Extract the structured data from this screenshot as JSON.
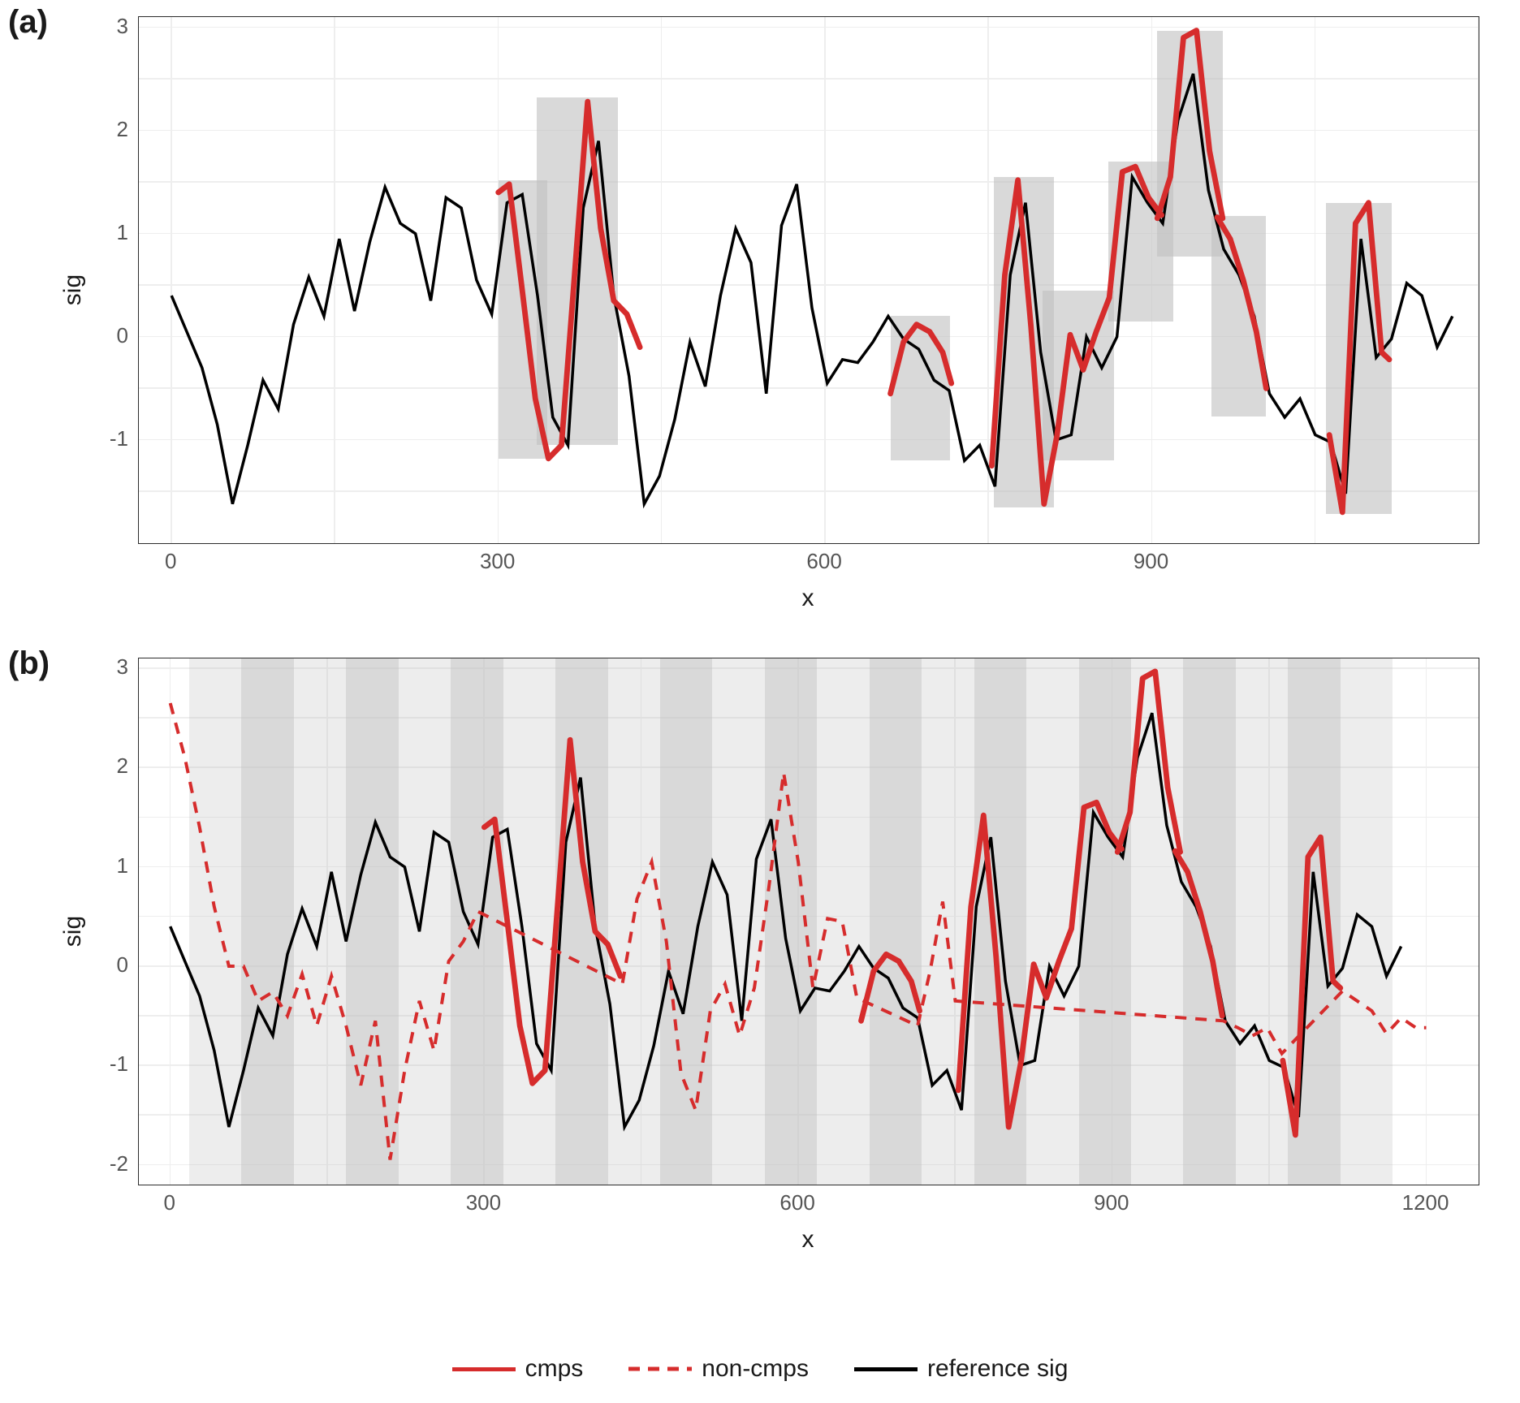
{
  "chart_data": [
    {
      "id": "a",
      "type": "line",
      "panel_label": "(a)",
      "xlabel": "x",
      "ylabel": "sig",
      "xlim": [
        -30,
        1200
      ],
      "ylim": [
        -2.0,
        3.1
      ],
      "xticks": [
        0,
        300,
        600,
        900
      ],
      "yticks": [
        -1,
        0,
        1,
        2,
        3
      ],
      "shaded_segments": [
        {
          "x0": 300,
          "x1": 345,
          "y0": -1.18,
          "y1": 1.52
        },
        {
          "x0": 335,
          "x1": 410,
          "y0": -1.05,
          "y1": 2.32
        },
        {
          "x0": 660,
          "x1": 715,
          "y0": -1.2,
          "y1": 0.2
        },
        {
          "x0": 755,
          "x1": 810,
          "y0": -1.65,
          "y1": 1.55
        },
        {
          "x0": 800,
          "x1": 865,
          "y0": -1.2,
          "y1": 0.45
        },
        {
          "x0": 860,
          "x1": 920,
          "y0": 0.15,
          "y1": 1.7
        },
        {
          "x0": 905,
          "x1": 965,
          "y0": 0.78,
          "y1": 2.97
        },
        {
          "x0": 955,
          "x1": 1005,
          "y0": -0.77,
          "y1": 1.17
        },
        {
          "x0": 1060,
          "x1": 1120,
          "y0": -1.72,
          "y1": 1.3
        }
      ],
      "series": [
        {
          "name": "reference sig",
          "style": "solid-black",
          "x": [
            0,
            14,
            28,
            42,
            56,
            70,
            84,
            98,
            112,
            126,
            140,
            154,
            168,
            182,
            196,
            210,
            224,
            238,
            252,
            266,
            280,
            294,
            308,
            322,
            336,
            350,
            364,
            378,
            392,
            406,
            420,
            434,
            448,
            462,
            476,
            490,
            504,
            518,
            532,
            546,
            560,
            574,
            588,
            602,
            616,
            630,
            644,
            658,
            672,
            686,
            700,
            714,
            728,
            742,
            756,
            770,
            784,
            798,
            812,
            826,
            840,
            854,
            868,
            882,
            896,
            910,
            924,
            938,
            952,
            966,
            980,
            994,
            1008,
            1022,
            1036,
            1050,
            1064,
            1078,
            1092,
            1106,
            1120,
            1134,
            1148,
            1162,
            1176
          ],
          "y": [
            0.4,
            0.05,
            -0.3,
            -0.85,
            -1.62,
            -1.05,
            -0.42,
            -0.7,
            0.12,
            0.58,
            0.2,
            0.95,
            0.25,
            0.92,
            1.45,
            1.1,
            1.0,
            0.35,
            1.35,
            1.25,
            0.55,
            0.22,
            1.3,
            1.38,
            0.4,
            -0.78,
            -1.05,
            1.25,
            1.9,
            0.4,
            -0.38,
            -1.62,
            -1.35,
            -0.8,
            -0.05,
            -0.48,
            0.4,
            1.05,
            0.72,
            -0.55,
            1.08,
            1.48,
            0.28,
            -0.45,
            -0.22,
            -0.25,
            -0.05,
            0.2,
            -0.02,
            -0.12,
            -0.42,
            -0.52,
            -1.2,
            -1.05,
            -1.45,
            0.6,
            1.3,
            -0.15,
            -1.0,
            -0.95,
            0.0,
            -0.3,
            0.0,
            1.55,
            1.3,
            1.1,
            2.1,
            2.55,
            1.42,
            0.85,
            0.6,
            0.2,
            -0.55,
            -0.78,
            -0.6,
            -0.95,
            -1.02,
            -1.52,
            0.95,
            -0.2,
            -0.02,
            0.52,
            0.4,
            -0.1,
            0.2
          ]
        },
        {
          "name": "cmps",
          "style": "solid-red",
          "segments": [
            {
              "x": [
                300,
                310,
                322,
                334,
                346,
                358,
                370,
                382,
                394,
                406,
                418,
                430
              ],
              "y": [
                1.4,
                1.48,
                0.45,
                -0.6,
                -1.18,
                -1.05,
                0.6,
                2.28,
                1.05,
                0.35,
                0.22,
                -0.1
              ]
            },
            {
              "x": [
                660,
                672,
                684,
                696,
                708,
                716
              ],
              "y": [
                -0.55,
                -0.05,
                0.12,
                0.05,
                -0.15,
                -0.45
              ]
            },
            {
              "x": [
                753,
                765,
                777,
                789,
                801,
                813,
                825,
                837,
                849,
                861
              ],
              "y": [
                -1.25,
                0.6,
                1.52,
                0.1,
                -1.62,
                -0.95,
                0.02,
                -0.32,
                0.05,
                0.38
              ]
            },
            {
              "x": [
                861,
                873,
                885,
                897,
                909
              ],
              "y": [
                0.38,
                1.6,
                1.65,
                1.35,
                1.18
              ]
            },
            {
              "x": [
                905,
                917,
                929,
                941,
                953,
                965
              ],
              "y": [
                1.15,
                1.55,
                2.9,
                2.97,
                1.8,
                1.15
              ]
            },
            {
              "x": [
                960,
                972,
                984,
                996,
                1005
              ],
              "y": [
                1.16,
                0.95,
                0.55,
                0.05,
                -0.5
              ]
            },
            {
              "x": [
                1063,
                1075,
                1087,
                1099,
                1111,
                1118
              ],
              "y": [
                -0.95,
                -1.7,
                1.1,
                1.3,
                -0.15,
                -0.22
              ]
            }
          ]
        }
      ]
    },
    {
      "id": "b",
      "type": "line",
      "panel_label": "(b)",
      "xlabel": "x",
      "ylabel": "sig",
      "xlim": [
        -30,
        1250
      ],
      "ylim": [
        -2.2,
        3.1
      ],
      "xticks": [
        0,
        300,
        600,
        900,
        1200
      ],
      "yticks": [
        -2,
        -1,
        0,
        1,
        2,
        3
      ],
      "stripes_start": 18,
      "stripes_width": 50,
      "stripes_end": 1168,
      "series": [
        {
          "name": "reference sig",
          "style": "solid-black",
          "x": [
            0,
            14,
            28,
            42,
            56,
            70,
            84,
            98,
            112,
            126,
            140,
            154,
            168,
            182,
            196,
            210,
            224,
            238,
            252,
            266,
            280,
            294,
            308,
            322,
            336,
            350,
            364,
            378,
            392,
            406,
            420,
            434,
            448,
            462,
            476,
            490,
            504,
            518,
            532,
            546,
            560,
            574,
            588,
            602,
            616,
            630,
            644,
            658,
            672,
            686,
            700,
            714,
            728,
            742,
            756,
            770,
            784,
            798,
            812,
            826,
            840,
            854,
            868,
            882,
            896,
            910,
            924,
            938,
            952,
            966,
            980,
            994,
            1008,
            1022,
            1036,
            1050,
            1064,
            1078,
            1092,
            1106,
            1120,
            1134,
            1148,
            1162,
            1176
          ],
          "y": [
            0.4,
            0.05,
            -0.3,
            -0.85,
            -1.62,
            -1.05,
            -0.42,
            -0.7,
            0.12,
            0.58,
            0.2,
            0.95,
            0.25,
            0.92,
            1.45,
            1.1,
            1.0,
            0.35,
            1.35,
            1.25,
            0.55,
            0.22,
            1.3,
            1.38,
            0.4,
            -0.78,
            -1.05,
            1.25,
            1.9,
            0.4,
            -0.38,
            -1.62,
            -1.35,
            -0.8,
            -0.05,
            -0.48,
            0.4,
            1.05,
            0.72,
            -0.55,
            1.08,
            1.48,
            0.28,
            -0.45,
            -0.22,
            -0.25,
            -0.05,
            0.2,
            -0.02,
            -0.12,
            -0.42,
            -0.52,
            -1.2,
            -1.05,
            -1.45,
            0.6,
            1.3,
            -0.15,
            -1.0,
            -0.95,
            0.0,
            -0.3,
            0.0,
            1.55,
            1.3,
            1.1,
            2.1,
            2.55,
            1.42,
            0.85,
            0.6,
            0.2,
            -0.55,
            -0.78,
            -0.6,
            -0.95,
            -1.02,
            -1.52,
            0.95,
            -0.2,
            -0.02,
            0.52,
            0.4,
            -0.1,
            0.2
          ]
        },
        {
          "name": "cmps",
          "style": "solid-red",
          "segments": [
            {
              "x": [
                300,
                310,
                322,
                334,
                346,
                358,
                370,
                382,
                394,
                406,
                418,
                430
              ],
              "y": [
                1.4,
                1.48,
                0.45,
                -0.6,
                -1.18,
                -1.05,
                0.6,
                2.28,
                1.05,
                0.35,
                0.22,
                -0.1
              ]
            },
            {
              "x": [
                660,
                672,
                684,
                696,
                708,
                716
              ],
              "y": [
                -0.55,
                -0.05,
                0.12,
                0.05,
                -0.15,
                -0.45
              ]
            },
            {
              "x": [
                753,
                765,
                777,
                789,
                801,
                813,
                825,
                837,
                849,
                861
              ],
              "y": [
                -1.25,
                0.6,
                1.52,
                0.1,
                -1.62,
                -0.95,
                0.02,
                -0.32,
                0.05,
                0.38
              ]
            },
            {
              "x": [
                861,
                873,
                885,
                897,
                909
              ],
              "y": [
                0.38,
                1.6,
                1.65,
                1.35,
                1.18
              ]
            },
            {
              "x": [
                905,
                917,
                929,
                941,
                953,
                965
              ],
              "y": [
                1.15,
                1.55,
                2.9,
                2.97,
                1.8,
                1.15
              ]
            },
            {
              "x": [
                960,
                972,
                984,
                996,
                1005
              ],
              "y": [
                1.16,
                0.95,
                0.55,
                0.05,
                -0.5
              ]
            },
            {
              "x": [
                1063,
                1075,
                1087,
                1099,
                1111,
                1118
              ],
              "y": [
                -0.95,
                -1.7,
                1.1,
                1.3,
                -0.15,
                -0.22
              ]
            }
          ]
        },
        {
          "name": "non-cmps",
          "style": "dashed-red",
          "x": [
            0,
            14,
            28,
            42,
            56,
            70,
            84,
            98,
            112,
            126,
            140,
            154,
            168,
            182,
            196,
            210,
            224,
            238,
            252,
            266,
            280,
            294,
            432,
            446,
            460,
            474,
            488,
            502,
            516,
            530,
            544,
            558,
            572,
            586,
            600,
            614,
            628,
            642,
            656,
            714,
            726,
            738,
            750,
            1006,
            1020,
            1034,
            1048,
            1062,
            1120,
            1134,
            1148,
            1162,
            1176,
            1190,
            1200
          ],
          "y": [
            2.65,
            2.1,
            1.4,
            0.6,
            0.0,
            0.0,
            -0.35,
            -0.26,
            -0.5,
            -0.08,
            -0.6,
            -0.1,
            -0.6,
            -1.2,
            -0.55,
            -1.95,
            -1.05,
            -0.35,
            -0.85,
            0.05,
            0.25,
            0.55,
            -0.18,
            0.68,
            1.05,
            0.25,
            -1.08,
            -1.45,
            -0.45,
            -0.18,
            -0.7,
            -0.22,
            0.8,
            1.95,
            1.05,
            -0.22,
            0.48,
            0.45,
            -0.32,
            -0.6,
            -0.05,
            0.65,
            -0.35,
            -0.55,
            -0.62,
            -0.7,
            -0.62,
            -0.88,
            -0.25,
            -0.35,
            -0.45,
            -0.68,
            -0.52,
            -0.62,
            -0.62
          ]
        }
      ]
    }
  ],
  "legend": {
    "items": [
      {
        "label": "cmps",
        "style": "solid-red"
      },
      {
        "label": "non-cmps",
        "style": "dashed-red"
      },
      {
        "label": "reference sig",
        "style": "solid-black"
      }
    ]
  }
}
